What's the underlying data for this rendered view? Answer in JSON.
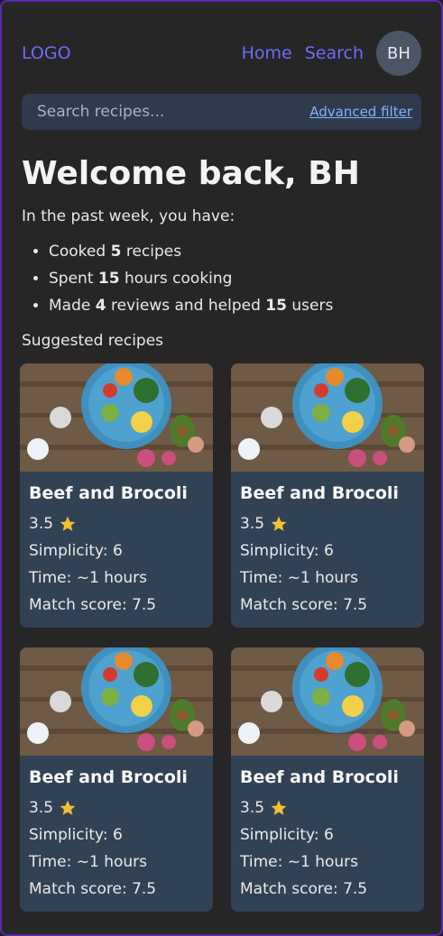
{
  "nav": {
    "logo": "LOGO",
    "links": [
      "Home",
      "Search"
    ],
    "avatar": "BH"
  },
  "search": {
    "placeholder": "Search recipes...",
    "advanced_filter": "Advanced filter"
  },
  "welcome": {
    "title": "Welcome back, BH",
    "intro": "In the past week, you have:",
    "stats": {
      "cooked_prefix": "Cooked",
      "cooked_count": "5",
      "cooked_suffix": "recipes",
      "spent_prefix": "Spent",
      "spent_count": "15",
      "spent_suffix": "hours cooking",
      "made_prefix": "Made",
      "reviews_count": "4",
      "reviews_middle": "reviews and helped",
      "users_count": "15",
      "users_suffix": "users"
    }
  },
  "suggested_label": "Suggested recipes",
  "recipes": [
    {
      "title": "Beef and Brocoli",
      "rating": "3.5",
      "simplicity": "Simplicity: 6",
      "time": "Time: ~1 hours",
      "match": "Match score: 7.5"
    },
    {
      "title": "Beef and Brocoli",
      "rating": "3.5",
      "simplicity": "Simplicity: 6",
      "time": "Time: ~1 hours",
      "match": "Match score: 7.5"
    },
    {
      "title": "Beef and Brocoli",
      "rating": "3.5",
      "simplicity": "Simplicity: 6",
      "time": "Time: ~1 hours",
      "match": "Match score: 7.5"
    },
    {
      "title": "Beef and Brocoli",
      "rating": "3.5",
      "simplicity": "Simplicity: 6",
      "time": "Time: ~1 hours",
      "match": "Match score: 7.5"
    }
  ],
  "colors": {
    "accent": "#6f6cf6",
    "card_bg": "#324255",
    "star": "#f2c12e",
    "link": "#7fb2ff"
  },
  "icons": [
    "star-icon",
    "recipe-food-image"
  ]
}
